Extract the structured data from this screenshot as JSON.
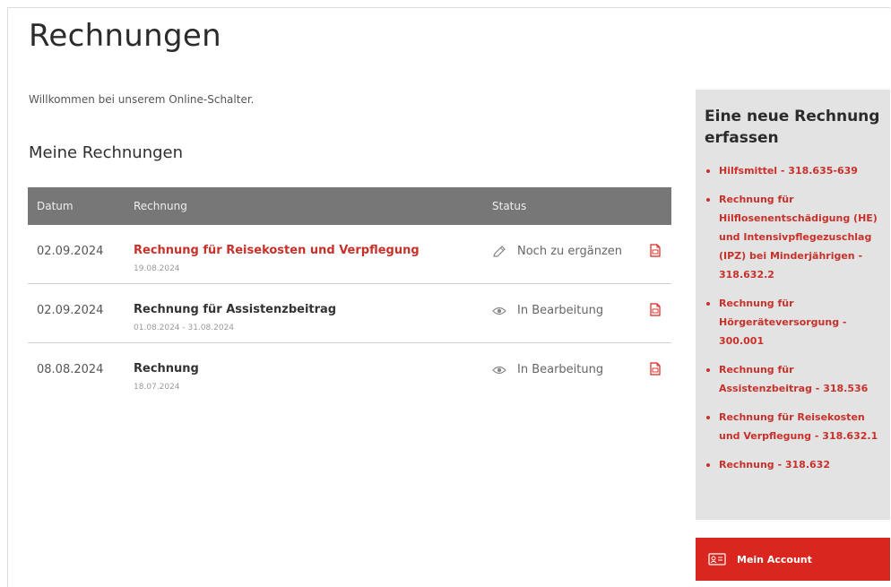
{
  "page": {
    "title": "Rechnungen",
    "welcome": "Willkommen bei unserem Online-Schalter.",
    "section_title": "Meine Rechnungen"
  },
  "table": {
    "headers": {
      "date": "Datum",
      "invoice": "Rechnung",
      "status": "Status"
    },
    "rows": [
      {
        "date": "02.09.2024",
        "title": "Rechnung für Reisekosten und Verpflegung",
        "subtitle": "19.08.2024",
        "status": "Noch zu ergänzen",
        "status_icon": "pencil-icon",
        "highlighted": true
      },
      {
        "date": "02.09.2024",
        "title": "Rechnung für Assistenzbeitrag",
        "subtitle": "01.08.2024 - 31.08.2024",
        "status": "In Bearbeitung",
        "status_icon": "eye-icon",
        "highlighted": false
      },
      {
        "date": "08.08.2024",
        "title": "Rechnung",
        "subtitle": "18.07.2024",
        "status": "In Bearbeitung",
        "status_icon": "eye-icon",
        "highlighted": false
      }
    ]
  },
  "sidebar": {
    "title": "Eine neue Rechnung erfassen",
    "items": [
      {
        "label": "Hilfsmittel - 318.635-639"
      },
      {
        "label": "Rechnung für Hilflosenentschädigung (HE) und Intensivpflegezuschlag (IPZ) bei Minderjährigen - 318.632.2"
      },
      {
        "label": "Rechnung für Hörgeräteversorgung - 300.001"
      },
      {
        "label": "Rechnung für Assistenzbeitrag - 318.536"
      },
      {
        "label": "Rechnung für Reisekosten und Verpflegung - 318.632.1"
      },
      {
        "label": "Rechnung - 318.632"
      }
    ]
  },
  "account_button": {
    "label": "Mein Account",
    "icon": "id-card-icon"
  },
  "colors": {
    "accent": "#c8312a",
    "account_bg": "#d9261f",
    "table_header_bg": "#777777",
    "sidebar_bg": "#e3e3e3"
  }
}
